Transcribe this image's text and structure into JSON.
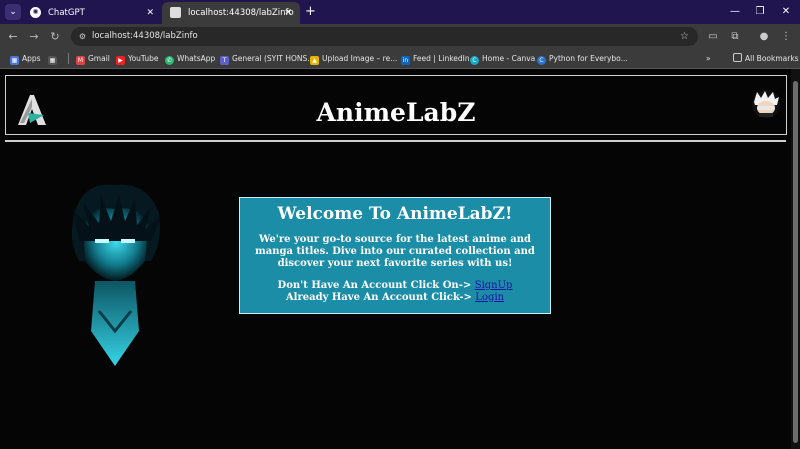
{
  "browser": {
    "tabs": [
      {
        "title": "ChatGPT",
        "icon": "chatgpt-icon"
      },
      {
        "title": "localhost:44308/labZinfo",
        "icon": "page-icon"
      }
    ],
    "url": "localhost:44308/labZinfo",
    "bookmarks": [
      {
        "label": "Apps",
        "icon": "apps-grid-icon"
      },
      {
        "label": "Gmail",
        "icon": "gmail-icon"
      },
      {
        "label": "YouTube",
        "icon": "youtube-icon"
      },
      {
        "label": "WhatsApp",
        "icon": "whatsapp-icon"
      },
      {
        "label": "General (SYIT HONS...",
        "icon": "teams-icon"
      },
      {
        "label": "Upload Image – re...",
        "icon": "upload-icon"
      },
      {
        "label": "Feed | LinkedIn",
        "icon": "linkedin-icon"
      },
      {
        "label": "Home - Canva",
        "icon": "canva-icon"
      },
      {
        "label": "Python for Everybo...",
        "icon": "coursera-icon"
      }
    ],
    "all_bookmarks": "All Bookmarks"
  },
  "page": {
    "site_title": "AnimeLabZ",
    "welcome_heading": "Welcome To AnimeLabZ!",
    "welcome_text": "We're your go-to source for the latest anime and manga titles. Dive into our curated collection and discover your next favorite series with us!",
    "signup_prompt": "Don't Have An Account Click On->",
    "signup_link": "SignUp",
    "login_prompt": "Already Have An Account Click->",
    "login_link": "Login"
  },
  "colors": {
    "panel_bg": "#1b8da6",
    "page_bg": "#050505",
    "tabstrip_bg": "#21154f"
  }
}
